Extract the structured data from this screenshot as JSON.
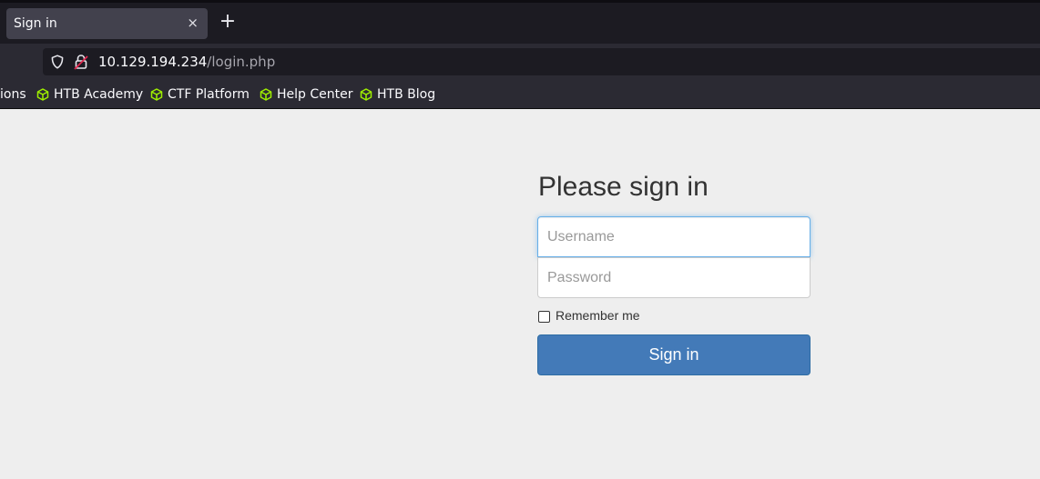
{
  "browser": {
    "tab": {
      "title": "Sign in",
      "close_glyph": "×"
    },
    "new_tab_glyph": "+",
    "url": {
      "host": "10.129.194.234",
      "path": "/login.php"
    },
    "bookmarks": [
      {
        "label": "ions",
        "icon": ""
      },
      {
        "label": "HTB Academy",
        "icon": "htb-cube-icon"
      },
      {
        "label": "CTF Platform",
        "icon": "htb-cube-icon"
      },
      {
        "label": "Help Center",
        "icon": "htb-cube-icon"
      },
      {
        "label": "HTB Blog",
        "icon": "htb-cube-icon"
      }
    ],
    "colors": {
      "bookmark_icon": "#9fef00",
      "chrome_dark": "#1c1b22",
      "chrome": "#2b2a33"
    }
  },
  "login": {
    "heading": "Please sign in",
    "username_placeholder": "Username",
    "password_placeholder": "Password",
    "remember_label": "Remember me",
    "remember_checked": false,
    "submit_label": "Sign in",
    "colors": {
      "button": "#437ab8",
      "focus": "#66afe9",
      "background": "#eeeeee"
    }
  }
}
